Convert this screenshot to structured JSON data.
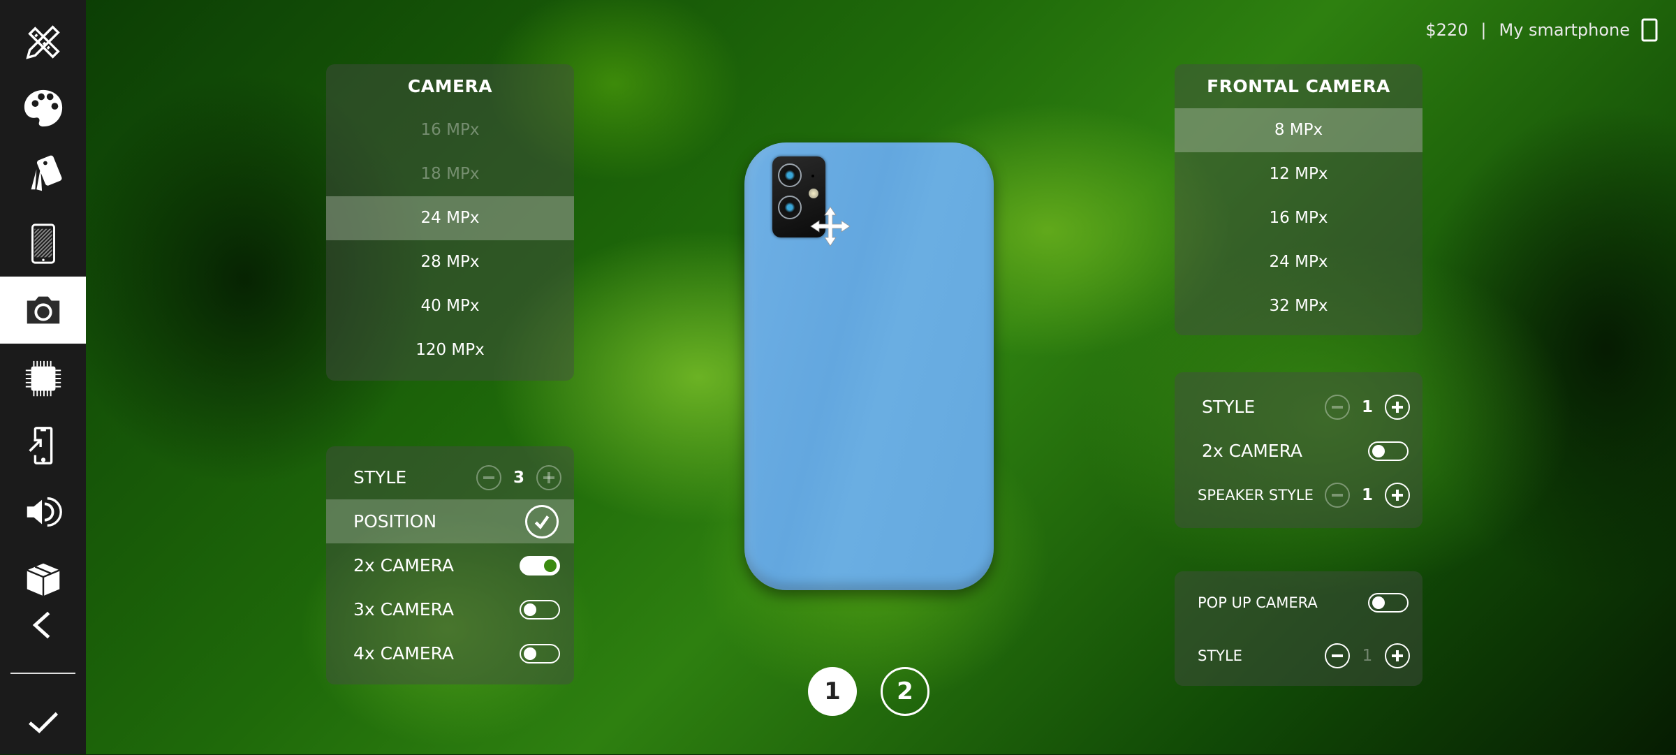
{
  "topbar": {
    "price": "$220",
    "separator": "|",
    "device_name": "My smartphone",
    "device_icon": "smartphone-outline-icon"
  },
  "sidebar": {
    "items": [
      {
        "name": "design-tools",
        "icon": "ruler-pencil-icon",
        "active": false
      },
      {
        "name": "colors",
        "icon": "palette-icon",
        "active": false
      },
      {
        "name": "materials",
        "icon": "material-swatches-icon",
        "active": false
      },
      {
        "name": "screen",
        "icon": "phone-screen-icon",
        "active": false
      },
      {
        "name": "camera",
        "icon": "camera-icon",
        "active": true
      },
      {
        "name": "processor",
        "icon": "chip-icon",
        "active": false
      },
      {
        "name": "ports",
        "icon": "phone-arrow-icon",
        "active": false
      },
      {
        "name": "sound",
        "icon": "speaker-icon",
        "active": false
      },
      {
        "name": "package",
        "icon": "box-icon",
        "active": false
      }
    ],
    "back_icon": "chevron-left-icon",
    "confirm_icon": "checkmark-icon"
  },
  "camera_panel": {
    "title": "CAMERA",
    "options": [
      {
        "label": "16 MPx",
        "state": "disabled"
      },
      {
        "label": "18 MPx",
        "state": "disabled"
      },
      {
        "label": "24 MPx",
        "state": "selected"
      },
      {
        "label": "28 MPx",
        "state": "normal"
      },
      {
        "label": "40 MPx",
        "state": "normal"
      },
      {
        "label": "120 MPx",
        "state": "normal"
      }
    ]
  },
  "camera_options": {
    "style_label": "STYLE",
    "style_value": "3",
    "position_label": "POSITION",
    "position_checked": true,
    "toggles": [
      {
        "label": "2x CAMERA",
        "on": true
      },
      {
        "label": "3x CAMERA",
        "on": false
      },
      {
        "label": "4x CAMERA",
        "on": false
      }
    ]
  },
  "frontal_panel": {
    "title": "FRONTAL CAMERA",
    "options": [
      {
        "label": "8 MPx",
        "state": "selected"
      },
      {
        "label": "12 MPx",
        "state": "normal"
      },
      {
        "label": "16 MPx",
        "state": "normal"
      },
      {
        "label": "24 MPx",
        "state": "normal"
      },
      {
        "label": "32 MPx",
        "state": "normal"
      }
    ]
  },
  "frontal_options": {
    "style_label": "STYLE",
    "style_value": "1",
    "dual_label": "2x CAMERA",
    "dual_on": false,
    "speaker_label": "SPEAKER STYLE",
    "speaker_value": "1"
  },
  "popup_options": {
    "popup_label": "POP UP CAMERA",
    "popup_on": false,
    "style_label": "STYLE",
    "style_value": "1"
  },
  "phone": {
    "color": "#65a9e0"
  },
  "pager": {
    "pages": [
      "1",
      "2"
    ],
    "active": "1"
  },
  "colors": {
    "sidebar_bg": "#1b1b1b",
    "toggle_on": "#3a8a10",
    "phone_body": "#65a9e0"
  }
}
